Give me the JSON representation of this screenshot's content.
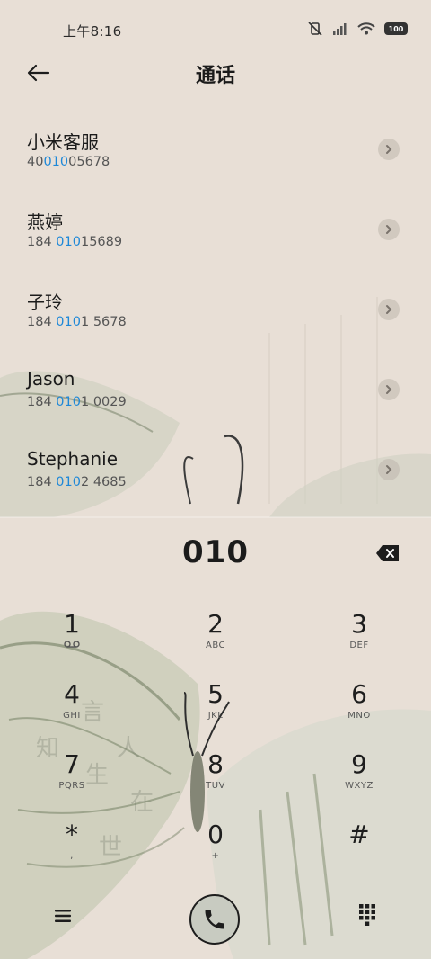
{
  "status": {
    "time": "上午8:16",
    "battery": "100"
  },
  "header": {
    "title": "通话"
  },
  "contacts": [
    {
      "name": "小米客服",
      "number_pre": "40",
      "number_hl": "010",
      "number_post": "05678"
    },
    {
      "name": "燕婷",
      "number_pre": "184 ",
      "number_hl": "010",
      "number_post": "15689"
    },
    {
      "name": "子玲",
      "number_pre": "184 ",
      "number_hl": "010",
      "number_post": "1 5678"
    },
    {
      "name": "Jason",
      "number_pre": "184 ",
      "number_hl": "010",
      "number_post": "1 0029"
    },
    {
      "name": "Stephanie",
      "number_pre": "184 ",
      "number_hl": "010",
      "number_post": "2 4685"
    }
  ],
  "dialer": {
    "entered": "010"
  },
  "keypad": [
    {
      "digit": "1",
      "letters": ""
    },
    {
      "digit": "2",
      "letters": "ABC"
    },
    {
      "digit": "3",
      "letters": "DEF"
    },
    {
      "digit": "4",
      "letters": "GHI"
    },
    {
      "digit": "5",
      "letters": "JKL"
    },
    {
      "digit": "6",
      "letters": "MNO"
    },
    {
      "digit": "7",
      "letters": "PQRS"
    },
    {
      "digit": "8",
      "letters": "TUV"
    },
    {
      "digit": "9",
      "letters": "WXYZ"
    },
    {
      "digit": "*",
      "letters": ","
    },
    {
      "digit": "0",
      "letters": "+"
    },
    {
      "digit": "#",
      "letters": ""
    }
  ],
  "icons": {
    "back": "back-arrow-icon",
    "backspace": "backspace-icon",
    "voicemail": "voicemail-icon",
    "menu": "menu-icon",
    "call": "phone-icon",
    "keypad": "dialpad-icon"
  },
  "colors": {
    "background": "#e8dfd6",
    "highlight": "#1e88d8",
    "call_button": "#c8cbc1"
  }
}
